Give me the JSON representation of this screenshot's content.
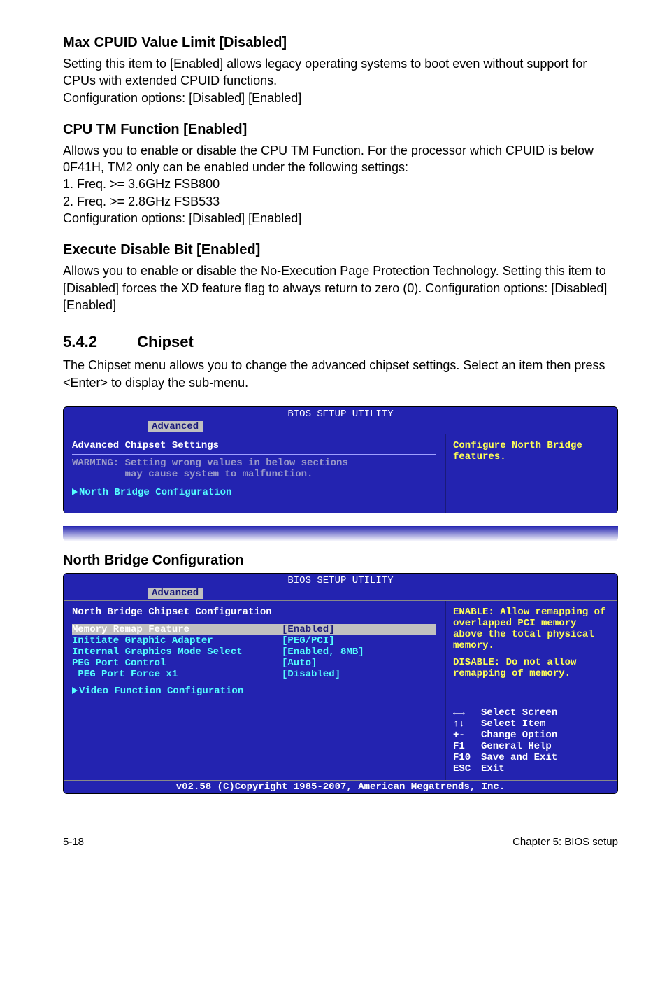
{
  "section1": {
    "title": "Max CPUID Value Limit [Disabled]",
    "body": "Setting this item to [Enabled] allows legacy operating systems to boot even without support for CPUs with extended CPUID functions.\nConfiguration options: [Disabled] [Enabled]"
  },
  "section2": {
    "title": "CPU TM Function [Enabled]",
    "body": "Allows you to enable or disable the CPU TM Function. For the processor which CPUID is below 0F41H, TM2 only can be enabled under the following settings:\n1. Freq. >= 3.6GHz FSB800\n2. Freq. >= 2.8GHz FSB533\nConfiguration options: [Disabled] [Enabled]"
  },
  "section3": {
    "title": "Execute Disable Bit [Enabled]",
    "body": "Allows you to enable or disable the No-Execution Page Protection Technology. Setting this item to [Disabled] forces the XD feature flag to always return to zero (0). Configuration options: [Disabled] [Enabled]"
  },
  "chipset_heading": {
    "num": "5.4.2",
    "title": "Chipset",
    "body": "The Chipset menu allows you to change the advanced chipset settings. Select an item then press <Enter> to display the sub-menu."
  },
  "bios1": {
    "utility_title": "BIOS SETUP UTILITY",
    "tab": "Advanced",
    "left_title": "Advanced Chipset Settings",
    "warning": "WARMING: Setting wrong values in below sections\n         may cause system to malfunction.",
    "item": "North Bridge Configuration",
    "help": "Configure North Bridge features."
  },
  "north_bridge_title": "North Bridge Configuration",
  "bios2": {
    "utility_title": "BIOS SETUP UTILITY",
    "tab": "Advanced",
    "left_title": "North Bridge Chipset Configuration",
    "rows": [
      {
        "label": "Memory Remap Feature",
        "value": "[Enabled]",
        "selected": true
      },
      {
        "label": "Initiate Graphic Adapter",
        "value": "[PEG/PCI]"
      },
      {
        "label": "Internal Graphics Mode Select",
        "value": "[Enabled, 8MB]"
      },
      {
        "label": "PEG Port Control",
        "value": "[Auto]"
      },
      {
        "label": " PEG Port Force x1",
        "value": "[Disabled]"
      }
    ],
    "subitem": "Video Function Configuration",
    "help_top": "ENABLE: Allow remapping of overlapped PCI memory above the total physical memory.",
    "help_mid": "DISABLE: Do not allow remapping of memory.",
    "nav": [
      {
        "key": "←→",
        "label": "Select Screen"
      },
      {
        "key": "↑↓",
        "label": "Select Item"
      },
      {
        "key": "+-",
        "label": "Change Option"
      },
      {
        "key": "F1",
        "label": "General Help"
      },
      {
        "key": "F10",
        "label": "Save and Exit"
      },
      {
        "key": "ESC",
        "label": "Exit"
      }
    ],
    "footer": "v02.58 (C)Copyright 1985-2007, American Megatrends, Inc."
  },
  "page_footer": {
    "left": "5-18",
    "right": "Chapter 5: BIOS setup"
  }
}
